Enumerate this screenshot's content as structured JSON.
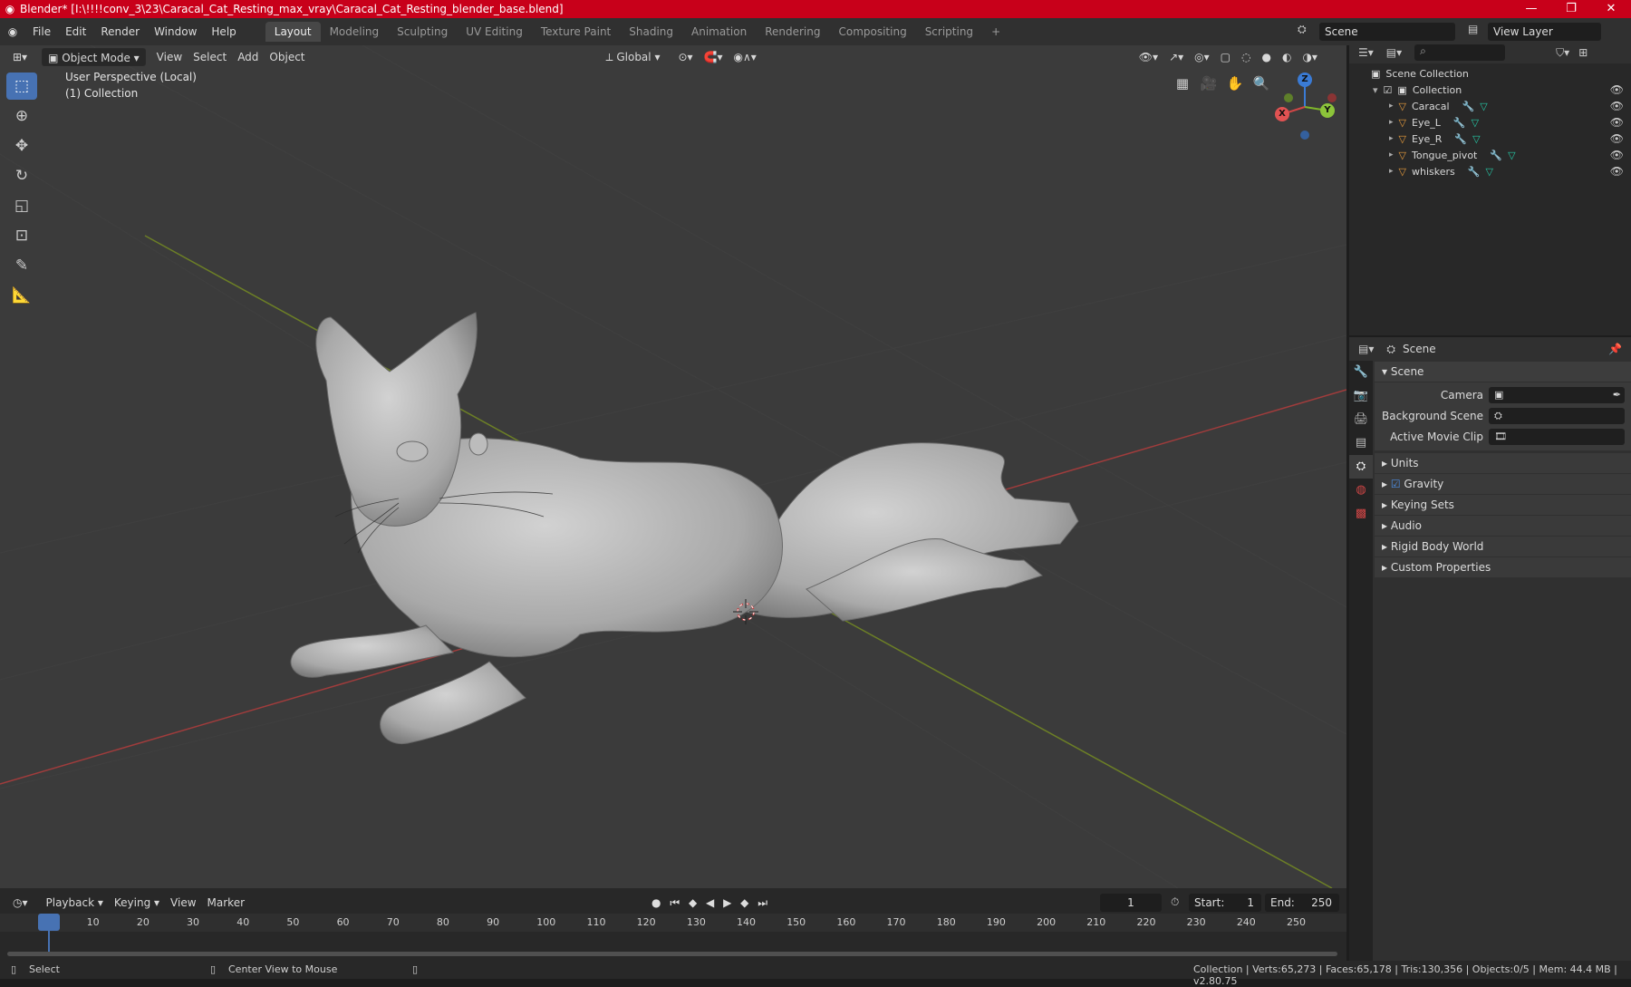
{
  "window": {
    "title": "Blender* [I:\\!!!!conv_3\\23\\Caracal_Cat_Resting_max_vray\\Caracal_Cat_Resting_blender_base.blend]",
    "controls": {
      "minimize": "—",
      "maximize": "❐",
      "close": "✕"
    },
    "accent": "#c8001a"
  },
  "menu": [
    "File",
    "Edit",
    "Render",
    "Window",
    "Help"
  ],
  "workspaces": [
    "Layout",
    "Modeling",
    "Sculpting",
    "UV Editing",
    "Texture Paint",
    "Shading",
    "Animation",
    "Rendering",
    "Compositing",
    "Scripting",
    "+"
  ],
  "active_workspace": "Layout",
  "scene_selector": "Scene",
  "view_layer": "View Layer",
  "viewport": {
    "mode": "Object Mode",
    "menus": [
      "View",
      "Select",
      "Add",
      "Object"
    ],
    "transform_orientation": "Global",
    "perspective_label": "User Perspective (Local)",
    "collection_label": "(1) Collection",
    "gizmo_axes": [
      "Z",
      "Y",
      "X"
    ],
    "background": "#3b3b3b"
  },
  "tools": [
    "select-box-icon",
    "cursor-icon",
    "move-icon",
    "rotate-icon",
    "scale-icon",
    "transform-icon",
    "annotate-icon",
    "measure-icon"
  ],
  "outliner": {
    "root": "Scene Collection",
    "collection": "Collection",
    "objects": [
      "Caracal",
      "Eye_L",
      "Eye_R",
      "Tongue_pivot",
      "whiskers"
    ]
  },
  "properties": {
    "context": "Scene",
    "panel_title": "Scene",
    "fields": [
      {
        "label": "Camera"
      },
      {
        "label": "Background Scene"
      },
      {
        "label": "Active Movie Clip"
      }
    ],
    "subpanels": [
      "Units",
      "Gravity",
      "Keying Sets",
      "Audio",
      "Rigid Body World",
      "Custom Properties"
    ],
    "gravity_checked": true
  },
  "timeline": {
    "menus": [
      "Playback",
      "Keying",
      "View",
      "Marker"
    ],
    "current_frame": "1",
    "start_label": "Start:",
    "start": "1",
    "end_label": "End:",
    "end": "250",
    "ticks": [
      "1",
      "10",
      "20",
      "30",
      "40",
      "50",
      "60",
      "70",
      "80",
      "90",
      "100",
      "110",
      "120",
      "130",
      "140",
      "150",
      "160",
      "170",
      "180",
      "190",
      "200",
      "210",
      "220",
      "230",
      "240",
      "250"
    ]
  },
  "status": {
    "left": "Select",
    "middle": "Center View to Mouse",
    "right": "Collection | Verts:65,273 | Faces:65,178 | Tris:130,356 | Objects:0/5 | Mem: 44.4 MB | v2.80.75"
  }
}
